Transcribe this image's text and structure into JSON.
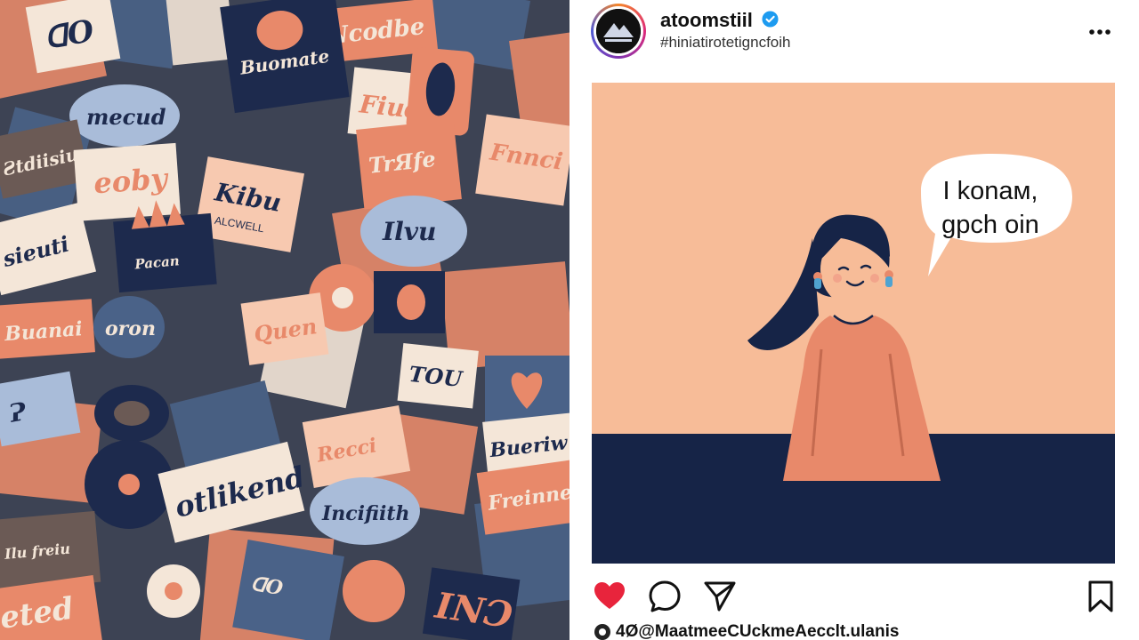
{
  "post": {
    "username": "atoomstiil",
    "subtitle": "#hiniatirotetigncfoih",
    "speech_bubble": {
      "line1": "I konaм,",
      "line2": "gpch oin"
    },
    "likes_text": "4Ø@MaatmeeCUckmeAecclt.ulanis",
    "liked": true
  },
  "collage": {
    "sticker_texts": [
      "ᗡO",
      "Nᴄodbe",
      "Buomate",
      "Fiud",
      "mecud",
      "Ƨtdiisiu",
      "eoby",
      "Kibu",
      "ΑLCWELL",
      "Pacan",
      "sieuti",
      "oron",
      "TOU",
      "Buanai",
      "Ɂ",
      "Bueriw",
      "otlikend",
      "Incifiith",
      "Freinne",
      "eted",
      "INƆ",
      "TrЯfe",
      "Fnnci",
      "Ilvu",
      "Recci",
      "Quen"
    ]
  },
  "colors": {
    "salmon": "#e8896a",
    "navy": "#1d2a4d",
    "slate": "#4a6288",
    "cream": "#f4e6d8",
    "peach": "#f7bc98",
    "heart": "#e8243c",
    "verified": "#1d9bf0"
  },
  "icons": {
    "like": "heart-icon",
    "comment": "comment-icon",
    "share": "send-icon",
    "save": "bookmark-icon",
    "more": "more-options-icon",
    "verified": "verified-badge-icon"
  }
}
